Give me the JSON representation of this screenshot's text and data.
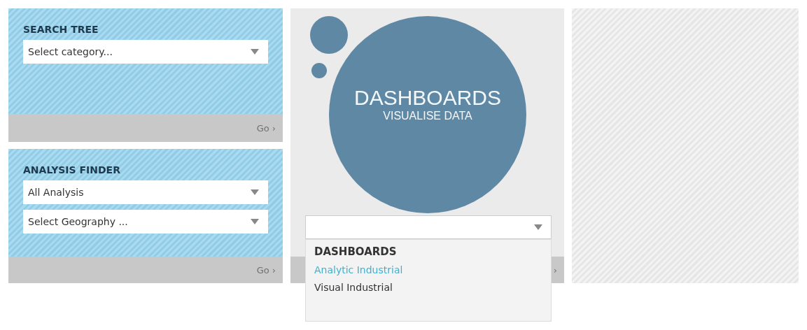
{
  "search_tree": {
    "title": "SEARCH TREE",
    "selects": [
      {
        "value": "Select category..."
      }
    ],
    "go": "Go ›"
  },
  "analysis_finder": {
    "title": "ANALYSIS FINDER",
    "selects": [
      {
        "value": "All Analysis"
      },
      {
        "value": "Select Geography ..."
      }
    ],
    "go": "Go ›"
  },
  "dashboards": {
    "title": "DASHBOARDS",
    "subtitle": "VISUALISE DATA",
    "footer_arrow": "›",
    "select": {
      "expanded": true
    },
    "menu": {
      "header": "DASHBOARDS",
      "items": [
        {
          "label": "Analytic Industrial",
          "selected": true
        },
        {
          "label": "Visual Industrial",
          "selected": false
        }
      ]
    }
  }
}
